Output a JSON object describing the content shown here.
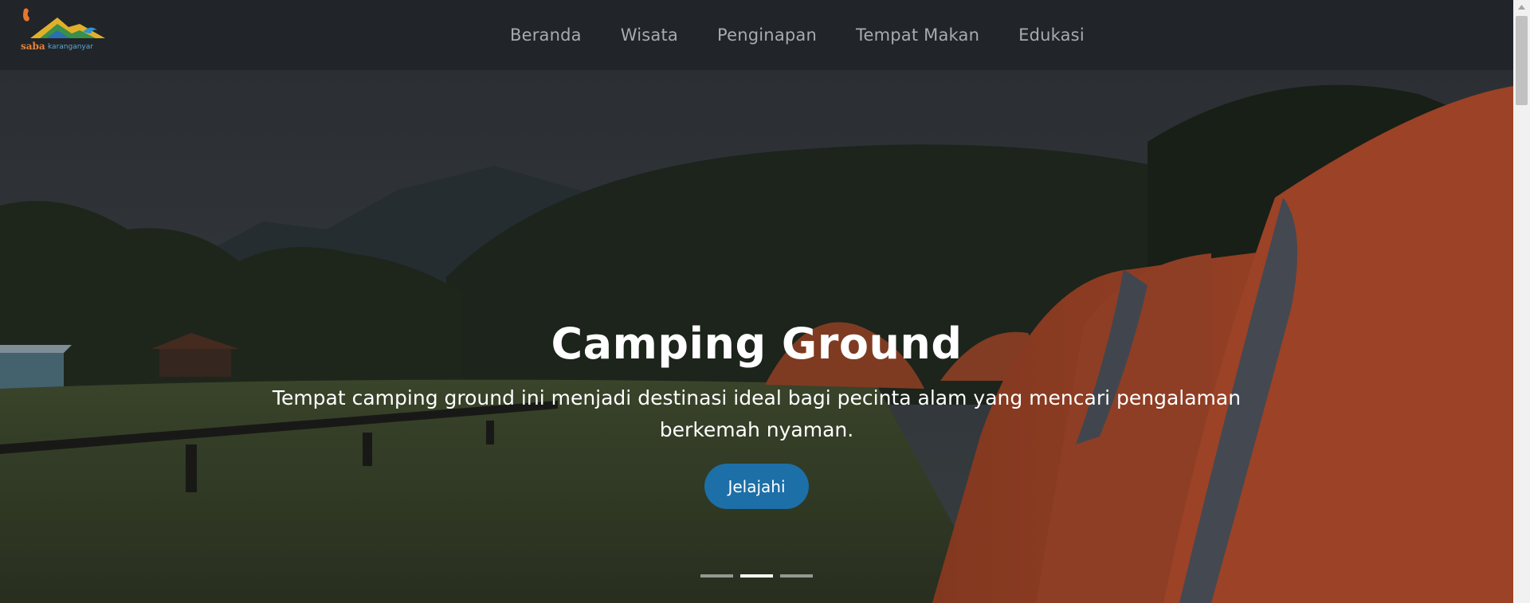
{
  "navbar": {
    "logo": {
      "word": "saba",
      "sub": "karanganyar"
    },
    "links": [
      "Beranda",
      "Wisata",
      "Penginapan",
      "Tempat Makan",
      "Edukasi"
    ]
  },
  "hero": {
    "title": "Camping Ground",
    "text": "Tempat camping ground ini menjadi destinasi ideal bagi pecinta alam yang mencari pengalaman berkemah nyaman.",
    "button_label": "Jelajahi",
    "slides_total": 3,
    "active_slide": 2
  },
  "colors": {
    "navbar_bg": "#212529",
    "nav_link": "#a7abb0",
    "button_bg": "#1c6fa7",
    "tent": "#a4472a"
  },
  "icons": {
    "scroll_up": "chevron-up-icon"
  }
}
